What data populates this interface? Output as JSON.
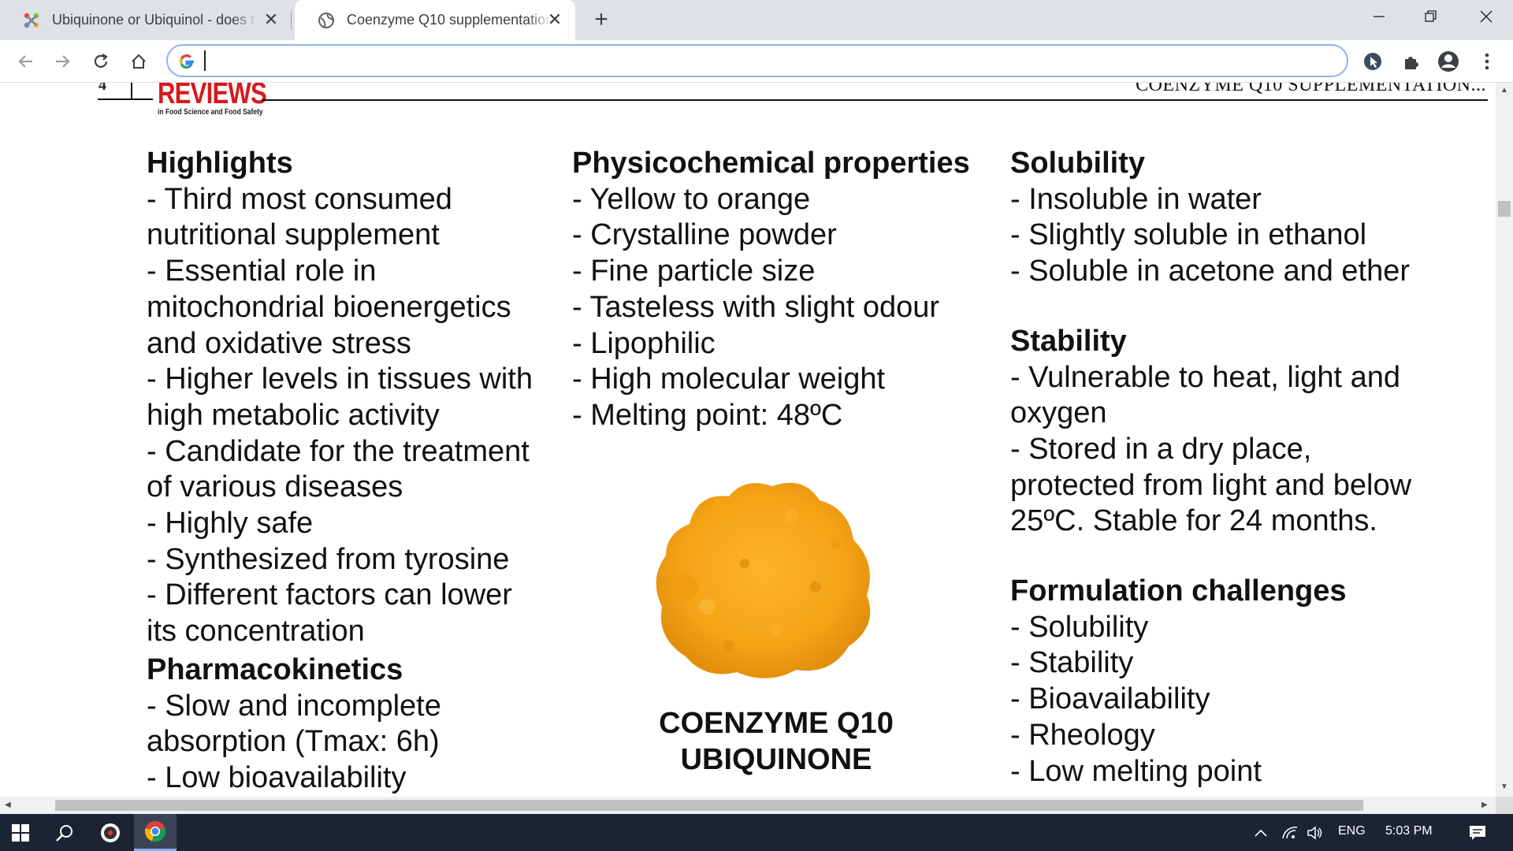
{
  "browser": {
    "tabs": [
      {
        "title": "Ubiquinone or Ubiquinol - does t",
        "icon": "joomla-icon",
        "active": false
      },
      {
        "title": "Coenzyme Q10 supplementation",
        "icon": "globe-icon",
        "active": true
      }
    ],
    "new_tab_label": "+",
    "address": {
      "value": "",
      "placeholder": ""
    },
    "accent_color": "#8ab4f8"
  },
  "page": {
    "page_number": "4",
    "journal_logo": {
      "word": "REVIEWS",
      "subtitle": "in Food Science and Food Safety"
    },
    "running_head": "COENZYME Q10 SUPPLEMENTATION...",
    "columns": [
      {
        "sections": [
          {
            "heading": "Highlights",
            "body": "- Third most consumed\nnutritional supplement\n- Essential role in\nmitochondrial bioenergetics\nand oxidative stress\n- Higher levels in tissues with\nhigh metabolic activity\n- Candidate for the treatment\nof various diseases\n- Highly safe\n- Synthesized from tyrosine\n- Different factors can lower\nits concentration"
          },
          {
            "heading": "Pharmacokinetics",
            "body": "- Slow and incomplete\nabsorption (Tmax: 6h)\n- Low bioavailability"
          }
        ]
      },
      {
        "sections": [
          {
            "heading": "Physicochemical properties",
            "body": "- Yellow to orange\n- Crystalline powder\n- Fine particle size\n- Tasteless with slight odour\n- Lipophilic\n- High molecular weight\n- Melting point: 48ºC"
          }
        ]
      },
      {
        "sections": [
          {
            "heading": "Solubility",
            "body": "- Insoluble in water\n- Slightly soluble in ethanol\n- Soluble in acetone and ether"
          },
          {
            "heading": "Stability",
            "body": "- Vulnerable to heat, light and\noxygen\n- Stored in a dry place,\nprotected from light and below\n25ºC. Stable for 24 months."
          },
          {
            "heading": "Formulation challenges",
            "body": "- Solubility\n- Stability\n- Bioavailability\n- Rheology\n- Low melting point"
          }
        ]
      }
    ],
    "product_name": "COENZYME Q10\nUBIQUINONE",
    "powder_color": "#f5a316",
    "logo_color": "#d7191c"
  },
  "taskbar": {
    "language": "ENG",
    "time": "5:03 PM",
    "background": "#1c2333"
  }
}
